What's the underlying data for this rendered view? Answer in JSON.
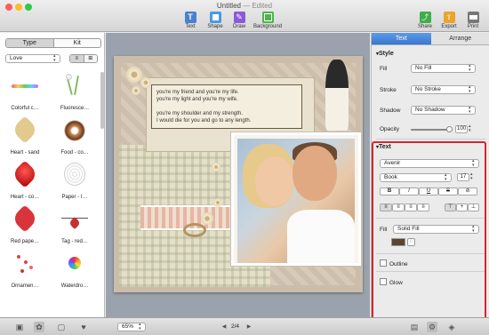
{
  "window": {
    "title": "Untitled",
    "status": "— Edited"
  },
  "toolbar": {
    "items": [
      {
        "label": "Text",
        "icon": "text-icon",
        "color": "#4a7fd4"
      },
      {
        "label": "Shape",
        "icon": "shape-icon",
        "color": "#4a9ae0"
      },
      {
        "label": "Draw",
        "icon": "draw-icon",
        "color": "#8a5ad8"
      },
      {
        "label": "Background",
        "icon": "background-icon",
        "color": "#4fb24a"
      }
    ],
    "right": [
      {
        "label": "Share",
        "icon": "share-icon",
        "color": "#3fae4a"
      },
      {
        "label": "Export",
        "icon": "export-icon",
        "color": "#e9a52b"
      },
      {
        "label": "Print",
        "icon": "print-icon",
        "color": "#777777"
      }
    ]
  },
  "left_panel": {
    "segments": [
      "Type",
      "Kit"
    ],
    "active_segment": "Type",
    "filter": "Love",
    "items": [
      {
        "label": "Colorful c…"
      },
      {
        "label": "Fluoresce…"
      },
      {
        "label": "Heart - sand"
      },
      {
        "label": "Food - co…"
      },
      {
        "label": "Heart - co…"
      },
      {
        "label": "Paper - I…"
      },
      {
        "label": "Red pape…"
      },
      {
        "label": "Tag - red…"
      },
      {
        "label": "Ornamen…"
      },
      {
        "label": "Waterdro…"
      }
    ]
  },
  "canvas": {
    "quote_lines": [
      "you're my friend and you're my life.",
      "you're my light and you're my wife.",
      "",
      "you're my shoulder and my strength.",
      "I would die for you and go to any length."
    ]
  },
  "inspector": {
    "tabs": [
      "Text",
      "Arrange"
    ],
    "active_tab": "Text",
    "style_section": "Style",
    "fill_label": "Fill",
    "fill_value": "No Fill",
    "stroke_label": "Stroke",
    "stroke_value": "No Stroke",
    "shadow_label": "Shadow",
    "shadow_value": "No Shadow",
    "opacity_label": "Opacity",
    "opacity_value": "100",
    "text_section": "Text",
    "font": "Avenir",
    "weight": "Book",
    "size": "17",
    "style_buttons": [
      "B",
      "I",
      "U",
      "S",
      "⊘"
    ],
    "text_fill_label": "Fill",
    "text_fill_value": "Solid Fill",
    "text_color": "#5a4530",
    "outline_label": "Outline",
    "glow_label": "Glow"
  },
  "bottom": {
    "zoom": "65%",
    "page_indicator": "2/4"
  },
  "accent": "#d9262e"
}
